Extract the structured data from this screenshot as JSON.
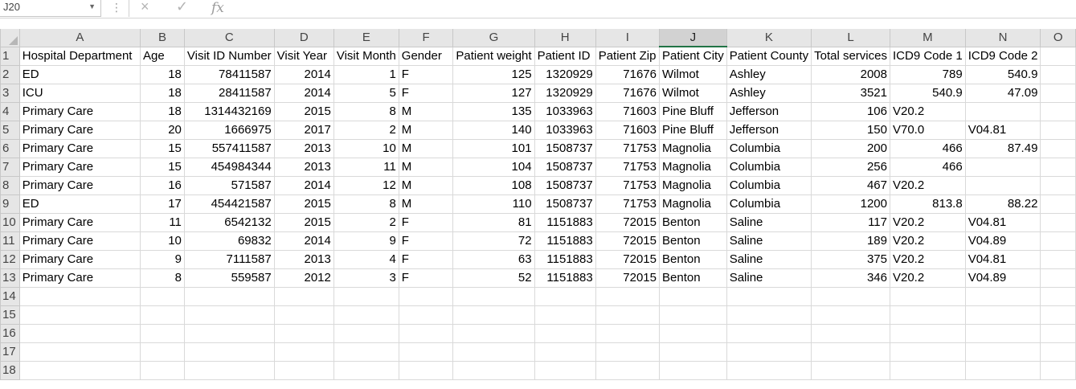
{
  "formula_bar": {
    "name_box": "J20",
    "name_box_dropdown_icon": "chevron-down-icon",
    "cancel_icon": "×",
    "enter_icon": "✓",
    "fx_label": "fx",
    "formula_value": ""
  },
  "columns": [
    "A",
    "B",
    "C",
    "D",
    "E",
    "F",
    "G",
    "H",
    "I",
    "J",
    "K",
    "L",
    "M",
    "N",
    "O"
  ],
  "selected_column": "J",
  "rows": [
    {
      "n": "1",
      "cells": [
        "Hospital Department",
        "Age",
        "Visit ID  Number",
        "Visit Year",
        "Visit Month",
        "Gender",
        "Patient weight",
        "Patient ID",
        "Patient Zip",
        "Patient City",
        "Patient County",
        "Total services",
        "ICD9 Code 1",
        "ICD9 Code 2",
        ""
      ]
    },
    {
      "n": "2",
      "cells": [
        "ED",
        "18",
        "78411587",
        "2014",
        "1",
        "F",
        "125",
        "1320929",
        "71676",
        "Wilmot",
        "Ashley",
        "2008",
        "789",
        "540.9",
        ""
      ]
    },
    {
      "n": "3",
      "cells": [
        "ICU",
        "18",
        "28411587",
        "2014",
        "5",
        "F",
        "127",
        "1320929",
        "71676",
        "Wilmot",
        "Ashley",
        "3521",
        "540.9",
        "47.09",
        ""
      ]
    },
    {
      "n": "4",
      "cells": [
        "Primary Care",
        "18",
        "1314432169",
        "2015",
        "8",
        "M",
        "135",
        "1033963",
        "71603",
        "Pine Bluff",
        "Jefferson",
        "106",
        "V20.2",
        "",
        ""
      ]
    },
    {
      "n": "5",
      "cells": [
        "Primary Care",
        "20",
        "1666975",
        "2017",
        "2",
        "M",
        "140",
        "1033963",
        "71603",
        "Pine Bluff",
        "Jefferson",
        "150",
        "V70.0",
        "V04.81",
        ""
      ]
    },
    {
      "n": "6",
      "cells": [
        "Primary Care",
        "15",
        "557411587",
        "2013",
        "10",
        "M",
        "101",
        "1508737",
        "71753",
        "Magnolia",
        "Columbia",
        "200",
        "466",
        "87.49",
        ""
      ]
    },
    {
      "n": "7",
      "cells": [
        "Primary Care",
        "15",
        "454984344",
        "2013",
        "11",
        "M",
        "104",
        "1508737",
        "71753",
        "Magnolia",
        "Columbia",
        "256",
        "466",
        "",
        ""
      ]
    },
    {
      "n": "8",
      "cells": [
        "Primary Care",
        "16",
        "571587",
        "2014",
        "12",
        "M",
        "108",
        "1508737",
        "71753",
        "Magnolia",
        "Columbia",
        "467",
        "V20.2",
        "",
        ""
      ]
    },
    {
      "n": "9",
      "cells": [
        "ED",
        "17",
        "454421587",
        "2015",
        "8",
        "M",
        "110",
        "1508737",
        "71753",
        "Magnolia",
        "Columbia",
        "1200",
        "813.8",
        "88.22",
        ""
      ]
    },
    {
      "n": "10",
      "cells": [
        "Primary Care",
        "11",
        "6542132",
        "2015",
        "2",
        "F",
        "81",
        "1151883",
        "72015",
        "Benton",
        "Saline",
        "117",
        "V20.2",
        "V04.81",
        ""
      ]
    },
    {
      "n": "11",
      "cells": [
        "Primary Care",
        "10",
        "69832",
        "2014",
        "9",
        "F",
        "72",
        "1151883",
        "72015",
        "Benton",
        "Saline",
        "189",
        "V20.2",
        "V04.89",
        ""
      ]
    },
    {
      "n": "12",
      "cells": [
        "Primary Care",
        "9",
        "7111587",
        "2013",
        "4",
        "F",
        "63",
        "1151883",
        "72015",
        "Benton",
        "Saline",
        "375",
        "V20.2",
        "V04.81",
        ""
      ]
    },
    {
      "n": "13",
      "cells": [
        "Primary Care",
        "8",
        "559587",
        "2012",
        "3",
        "F",
        "52",
        "1151883",
        "72015",
        "Benton",
        "Saline",
        "346",
        "V20.2",
        "V04.89",
        ""
      ]
    },
    {
      "n": "14",
      "cells": [
        "",
        "",
        "",
        "",
        "",
        "",
        "",
        "",
        "",
        "",
        "",
        "",
        "",
        "",
        ""
      ]
    },
    {
      "n": "15",
      "cells": [
        "",
        "",
        "",
        "",
        "",
        "",
        "",
        "",
        "",
        "",
        "",
        "",
        "",
        "",
        ""
      ]
    },
    {
      "n": "16",
      "cells": [
        "",
        "",
        "",
        "",
        "",
        "",
        "",
        "",
        "",
        "",
        "",
        "",
        "",
        "",
        ""
      ]
    },
    {
      "n": "17",
      "cells": [
        "",
        "",
        "",
        "",
        "",
        "",
        "",
        "",
        "",
        "",
        "",
        "",
        "",
        "",
        ""
      ]
    },
    {
      "n": "18",
      "cells": [
        "",
        "",
        "",
        "",
        "",
        "",
        "",
        "",
        "",
        "",
        "",
        "",
        "",
        "",
        ""
      ]
    }
  ],
  "colors": {
    "selected_column_accent": "#217346",
    "header_bg": "#e6e6e6",
    "gridline": "#d9d9d9"
  }
}
